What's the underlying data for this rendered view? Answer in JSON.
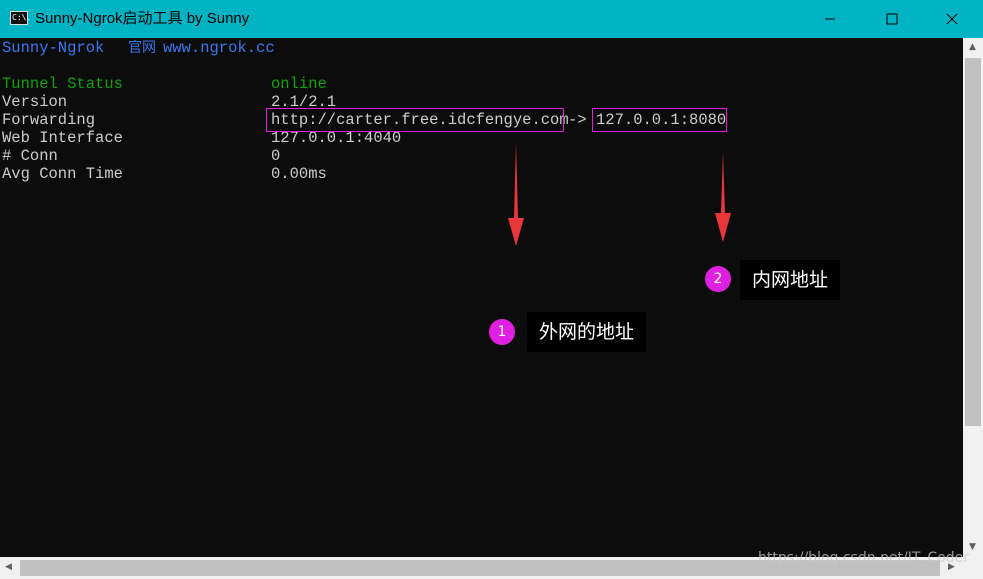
{
  "window": {
    "title": "Sunny-Ngrok启动工具 by Sunny",
    "icon_label": "C:\\."
  },
  "terminal": {
    "header": {
      "app": "Sunny-Ngrok",
      "site_label": "官网",
      "site_url": "www.ngrok.cc"
    },
    "rows": [
      {
        "key": "Tunnel Status",
        "value": "online"
      },
      {
        "key": "Version",
        "value": "2.1/2.1"
      },
      {
        "key": "Forwarding",
        "value_external": "http://carter.free.idcfengye.com",
        "arrow": "->",
        "value_local": "127.0.0.1:8080"
      },
      {
        "key": "Web Interface",
        "value": "127.0.0.1:4040"
      },
      {
        "key": "# Conn",
        "value": "0"
      },
      {
        "key": "Avg Conn Time",
        "value": "0.00ms"
      }
    ]
  },
  "annotations": [
    {
      "number": "1",
      "text": "外网的地址"
    },
    {
      "number": "2",
      "text": "内网地址"
    }
  ],
  "watermark": "https://blog.csdn.net/IT_Coder",
  "colors": {
    "titlebar": "#00b4c4",
    "highlight": "#e020e0",
    "arrow": "#e8363a",
    "status_green": "#13a10e",
    "header_blue": "#3a78f0"
  }
}
